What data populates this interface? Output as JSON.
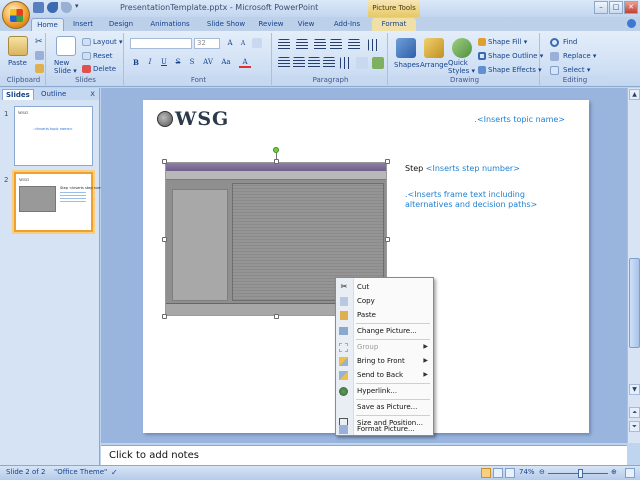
{
  "window": {
    "title": "PresentationTemplate.pptx - Microsoft PowerPoint",
    "context_tab_group": "Picture Tools",
    "buttons": {
      "minimize": "–",
      "maximize": "□",
      "close": "✕"
    }
  },
  "tabs": [
    "Home",
    "Insert",
    "Design",
    "Animations",
    "Slide Show",
    "Review",
    "View",
    "Add-Ins",
    "Format"
  ],
  "active_tab": "Home",
  "ribbon": {
    "clipboard": {
      "label": "Clipboard",
      "paste": "Paste"
    },
    "slides": {
      "label": "Slides",
      "new_slide": "New Slide ▾",
      "layout": "Layout ▾",
      "reset": "Reset",
      "delete": "Delete"
    },
    "font": {
      "label": "Font",
      "font_size": "32"
    },
    "paragraph": {
      "label": "Paragraph"
    },
    "drawing": {
      "label": "Drawing",
      "shapes": "Shapes",
      "arrange": "Arrange",
      "quick_styles": "Quick Styles ▾",
      "shape_fill": "Shape Fill ▾",
      "shape_outline": "Shape Outline ▾",
      "shape_effects": "Shape Effects ▾"
    },
    "editing": {
      "label": "Editing",
      "find": "Find",
      "replace": "Replace ▾",
      "select": "Select ▾"
    }
  },
  "left_panel": {
    "tabs": [
      "Slides",
      "Outline"
    ],
    "active_tab": "Slides",
    "close": "x",
    "slides": [
      {
        "number": "1",
        "text": ".<Inserts topic name>"
      },
      {
        "number": "2",
        "text": "Step <Inserts step number>"
      }
    ]
  },
  "slide": {
    "logo_text": "WSG",
    "topic": ".<Inserts topic name>",
    "step_label": "Step",
    "step_placeholder": "<Inserts step number>",
    "frame_text": ".<Inserts frame text including alternatives and decision paths>"
  },
  "context_menu": {
    "items": [
      {
        "label": "Cut",
        "icon": "scissors-icon",
        "disabled": false,
        "submenu": false
      },
      {
        "label": "Copy",
        "icon": "copy-icon",
        "disabled": false,
        "submenu": false
      },
      {
        "label": "Paste",
        "icon": "paste-icon",
        "disabled": false,
        "submenu": false
      },
      {
        "label": "Change Picture...",
        "icon": "change-picture-icon",
        "disabled": false,
        "submenu": false
      },
      {
        "label": "Group",
        "icon": "group-icon",
        "disabled": true,
        "submenu": true
      },
      {
        "label": "Bring to Front",
        "icon": "bring-front-icon",
        "disabled": false,
        "submenu": true
      },
      {
        "label": "Send to Back",
        "icon": "send-back-icon",
        "disabled": false,
        "submenu": true
      },
      {
        "label": "Hyperlink...",
        "icon": "hyperlink-icon",
        "disabled": false,
        "submenu": false
      },
      {
        "label": "Save as Picture...",
        "icon": "",
        "disabled": false,
        "submenu": false
      },
      {
        "label": "Size and Position...",
        "icon": "size-position-icon",
        "disabled": false,
        "submenu": false
      },
      {
        "label": "Format Picture...",
        "icon": "format-picture-icon",
        "disabled": false,
        "submenu": false
      }
    ]
  },
  "notes": {
    "placeholder": "Click to add notes"
  },
  "status": {
    "slide_info": "Slide 2 of 2",
    "theme": "\"Office Theme\"",
    "zoom": "74%",
    "zoom_fraction": 0.55
  },
  "colors": {
    "ribbon_bg": "#dfeaf8",
    "accent_blue": "#15428b",
    "placeholder_blue": "#1f7fd0",
    "selection_orange": "#f0a030"
  }
}
